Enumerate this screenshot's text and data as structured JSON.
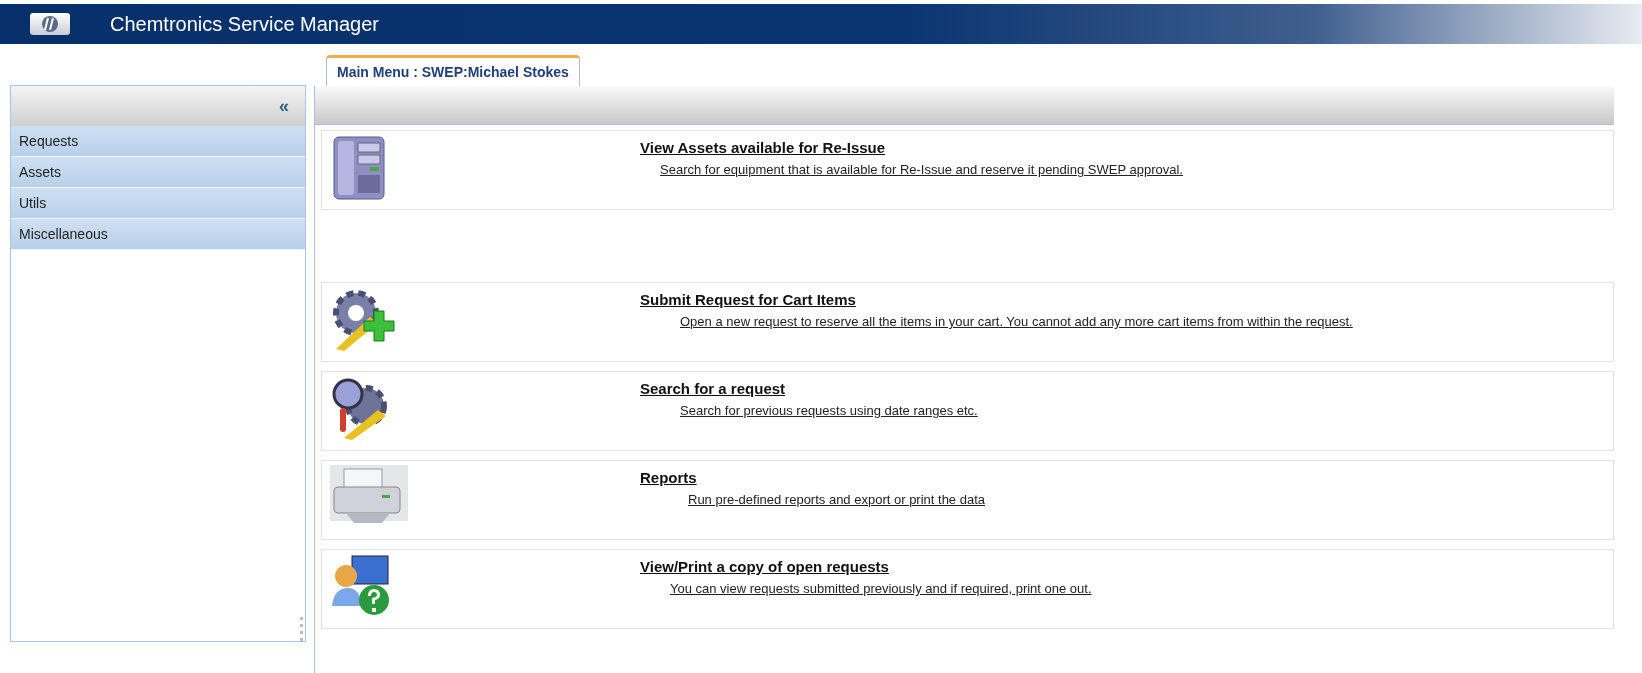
{
  "header": {
    "title": "Chemtronics Service Manager"
  },
  "sidebar": {
    "collapse": "«",
    "items": [
      {
        "label": "Requests"
      },
      {
        "label": "Assets"
      },
      {
        "label": "Utils"
      },
      {
        "label": "Miscellaneous"
      }
    ]
  },
  "tabs": [
    {
      "label": "Main Menu : SWEP:Michael Stokes",
      "selected": true
    }
  ],
  "menu": [
    {
      "title": "View Assets available for Re-Issue",
      "description": "Search for equipment that is available for Re-Issue and reserve it pending SWEP approval."
    },
    {
      "title": "Submit Request for Cart Items",
      "description": "Open a new request to reserve all the items in your cart. You cannot add any more cart items from within the request."
    },
    {
      "title": "Search for a request",
      "description": "Search for previous requests using date ranges etc."
    },
    {
      "title": "Reports",
      "description": "Run pre-defined reports and export or print the data"
    },
    {
      "title": "View/Print a copy of open requests",
      "description": "You can view requests submitted previously and if required, print one out."
    }
  ]
}
